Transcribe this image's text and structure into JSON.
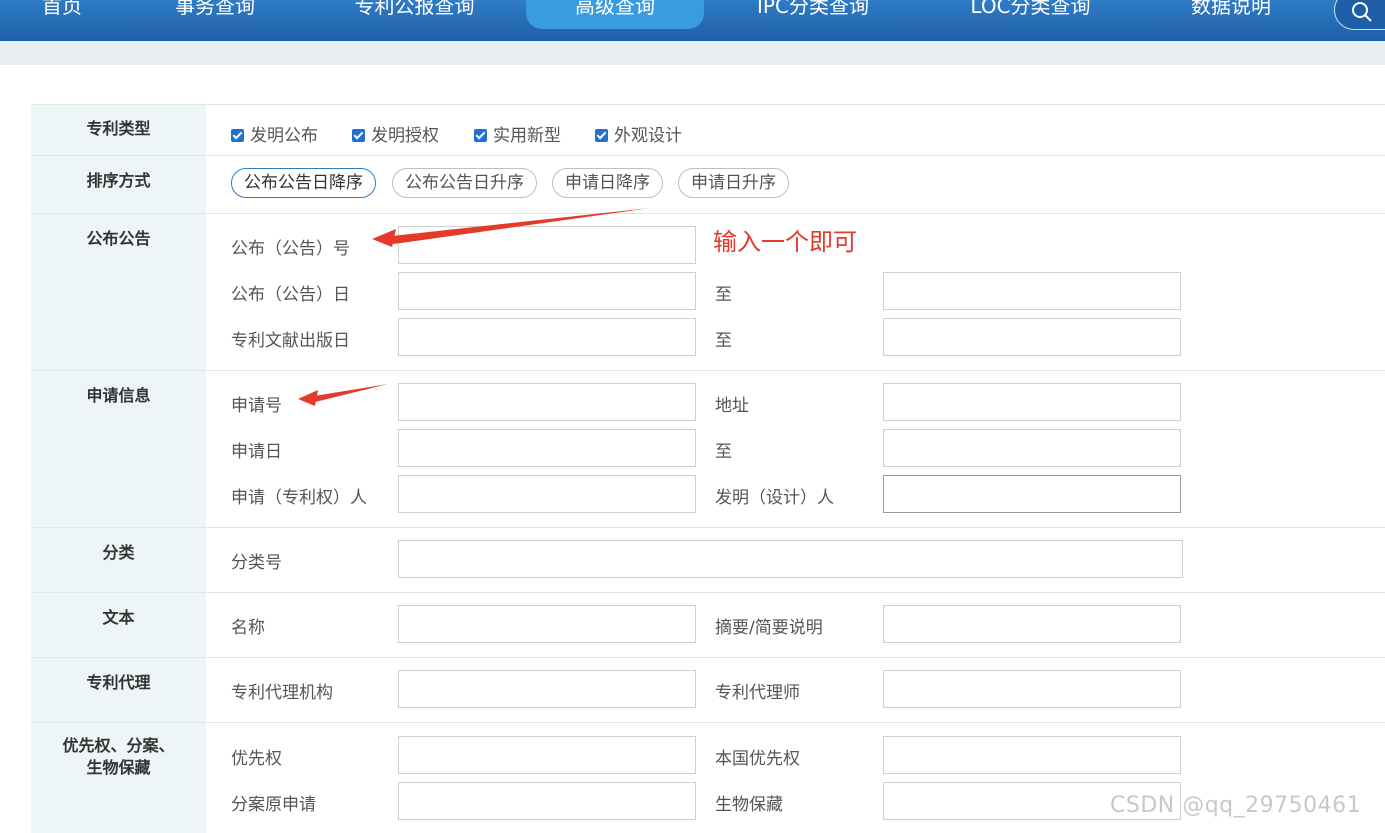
{
  "nav": {
    "items": [
      "首页",
      "事务查询",
      "专利公报查询",
      "高级查询",
      "IPC分类查询",
      "LOC分类查询",
      "数据说明"
    ],
    "active": "高级查询",
    "search_icon": "search-icon"
  },
  "sections": {
    "patent_type": {
      "label": "专利类型",
      "options": [
        {
          "label": "发明公布",
          "checked": true
        },
        {
          "label": "发明授权",
          "checked": true
        },
        {
          "label": "实用新型",
          "checked": true
        },
        {
          "label": "外观设计",
          "checked": true
        }
      ]
    },
    "sort": {
      "label": "排序方式",
      "options": [
        "公布公告日降序",
        "公布公告日升序",
        "申请日降序",
        "申请日升序"
      ],
      "selected": "公布公告日降序"
    },
    "publication": {
      "label": "公布公告",
      "pub_no_label": "公布（公告）号",
      "pub_date_label": "公布（公告）日",
      "pub_date_to": "至",
      "doc_date_label": "专利文献出版日",
      "doc_date_to": "至"
    },
    "application": {
      "label": "申请信息",
      "app_no_label": "申请号",
      "address_label": "地址",
      "app_date_label": "申请日",
      "app_date_to": "至",
      "applicant_label": "申请（专利权）人",
      "inventor_label": "发明（设计）人"
    },
    "classification": {
      "label": "分类",
      "class_no_label": "分类号"
    },
    "text": {
      "label": "文本",
      "name_label": "名称",
      "abstract_label": "摘要/简要说明"
    },
    "agency": {
      "label": "专利代理",
      "agency_label": "专利代理机构",
      "agent_label": "专利代理师"
    },
    "priority": {
      "label_line1": "优先权、分案、",
      "label_line2": "生物保藏",
      "priority_label": "优先权",
      "domestic_priority_label": "本国优先权",
      "divisional_label": "分案原申请",
      "bio_label": "生物保藏"
    }
  },
  "annotation": {
    "text": "输入一个即可",
    "color": "#e53a2a"
  },
  "watermark": "CSDN @qq_29750461",
  "colors": {
    "nav_bg": "#1f5fa8",
    "nav_active": "#3a9be0",
    "label_bg": "#eef5f7",
    "checkbox": "#1f6fd6"
  }
}
